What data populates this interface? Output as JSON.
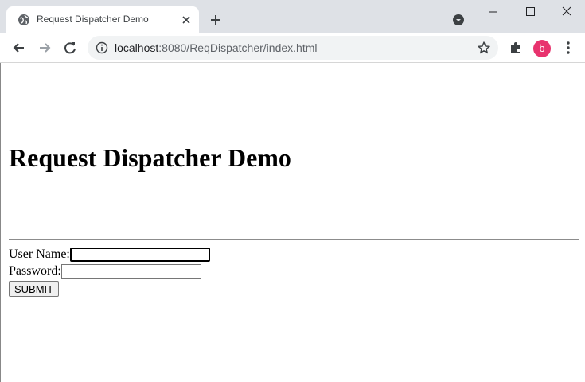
{
  "browser": {
    "tab": {
      "title": "Request Dispatcher Demo",
      "favicon": "globe-icon"
    },
    "new_tab_icon": "plus-icon",
    "address_bar": {
      "host": "localhost",
      "path": ":8080/ReqDispatcher/index.html"
    },
    "profile_initial": "b",
    "accent": "#e8336e"
  },
  "page": {
    "heading": "Request Dispatcher Demo",
    "form": {
      "username_label": "User Name:",
      "username_value": "",
      "password_label": "Password:",
      "password_value": "",
      "submit_label": "SUBMIT"
    }
  }
}
